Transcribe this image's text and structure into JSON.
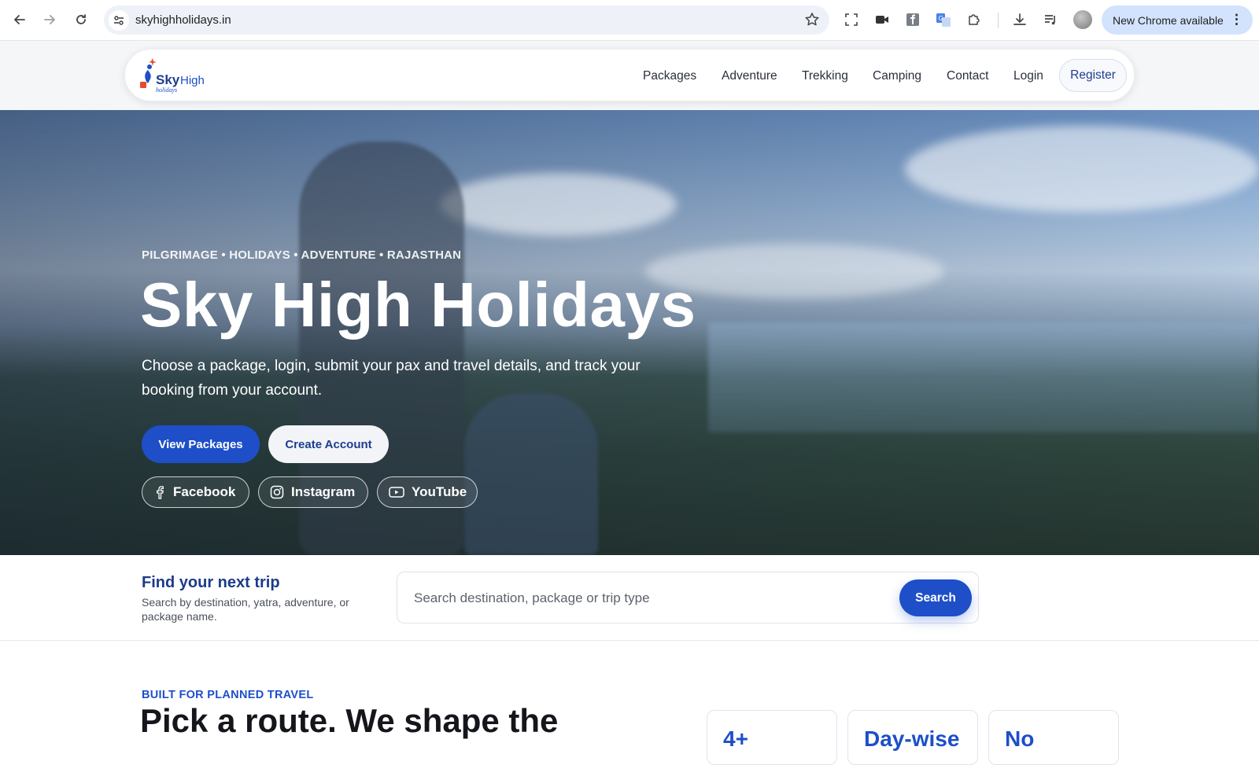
{
  "browser": {
    "url": "skyhighholidays.in",
    "update_label": "New Chrome available",
    "menu_glyph": "⋮"
  },
  "site": {
    "nav": {
      "packages": "Packages",
      "adventure": "Adventure",
      "trekking": "Trekking",
      "camping": "Camping",
      "contact": "Contact",
      "login": "Login",
      "register": "Register"
    },
    "logo": {
      "text_primary": "Sky",
      "text_secondary": "High",
      "text_tag": "holidays"
    }
  },
  "hero": {
    "eyebrow": "PILGRIMAGE • HOLIDAYS • ADVENTURE • RAJASTHAN",
    "title": "Sky High Holidays",
    "subtitle": "Choose a package, login, submit your pax and travel details, and track your booking from your account.",
    "primary_cta": "View Packages",
    "secondary_cta": "Create Account",
    "social": {
      "facebook": "Facebook",
      "instagram": "Instagram",
      "youtube": "YouTube"
    }
  },
  "search": {
    "title": "Find your next trip",
    "subtitle": "Search by destination, yatra, adventure, or package name.",
    "placeholder": "Search destination, package or trip type",
    "button": "Search"
  },
  "features": {
    "eyebrow": "BUILT FOR PLANNED TRAVEL",
    "title": "Pick a route. We shape the",
    "stats": [
      "4+",
      "Day-wise",
      "No"
    ]
  },
  "colors": {
    "brand_blue": "#1e4fc9",
    "nav_text": "#2a2f3a",
    "heading_dark": "#14161b"
  }
}
